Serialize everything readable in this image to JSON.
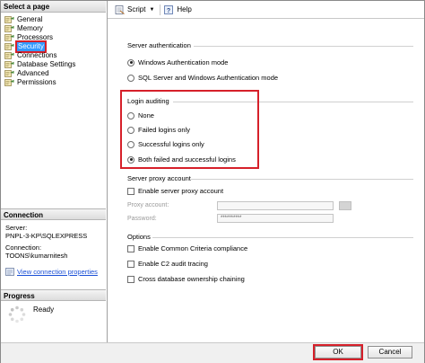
{
  "left": {
    "select_page_title": "Select a page",
    "pages": [
      {
        "label": "General"
      },
      {
        "label": "Memory"
      },
      {
        "label": "Processors"
      },
      {
        "label": "Security"
      },
      {
        "label": "Connections"
      },
      {
        "label": "Database Settings"
      },
      {
        "label": "Advanced"
      },
      {
        "label": "Permissions"
      }
    ],
    "selected_page": "Security",
    "connection_title": "Connection",
    "server_label": "Server:",
    "server_value": "PNPL-3-KP\\SQLEXPRESS",
    "connection_label": "Connection:",
    "connection_value": "TOONS\\kumarnitesh",
    "view_connection_properties": "View connection properties",
    "progress_title": "Progress",
    "progress_status": "Ready"
  },
  "toolbar": {
    "script_label": "Script",
    "help_label": "Help",
    "script_icon": "script-icon",
    "help_icon": "help-icon"
  },
  "security": {
    "server_auth_title": "Server authentication",
    "auth_options": [
      {
        "label": "Windows Authentication mode",
        "selected": true
      },
      {
        "label": "SQL Server and Windows Authentication mode",
        "selected": false
      }
    ],
    "login_auditing_title": "Login auditing",
    "audit_options": [
      {
        "label": "None",
        "selected": false
      },
      {
        "label": "Failed logins only",
        "selected": false
      },
      {
        "label": "Successful logins only",
        "selected": false
      },
      {
        "label": "Both failed and successful logins",
        "selected": true
      }
    ],
    "proxy_title": "Server proxy account",
    "enable_proxy_label": "Enable server proxy account",
    "enable_proxy_checked": false,
    "proxy_account_label": "Proxy account:",
    "password_label": "Password:",
    "password_value": "**********",
    "options_title": "Options",
    "options": [
      {
        "label": "Enable Common Criteria compliance",
        "checked": false
      },
      {
        "label": "Enable C2 audit tracing",
        "checked": false
      },
      {
        "label": "Cross database ownership chaining",
        "checked": false
      }
    ]
  },
  "footer": {
    "ok_label": "OK",
    "cancel_label": "Cancel"
  },
  "colors": {
    "highlight_red": "#d6202a",
    "selection_blue": "#3399ff",
    "link_blue": "#1a4fd6"
  }
}
